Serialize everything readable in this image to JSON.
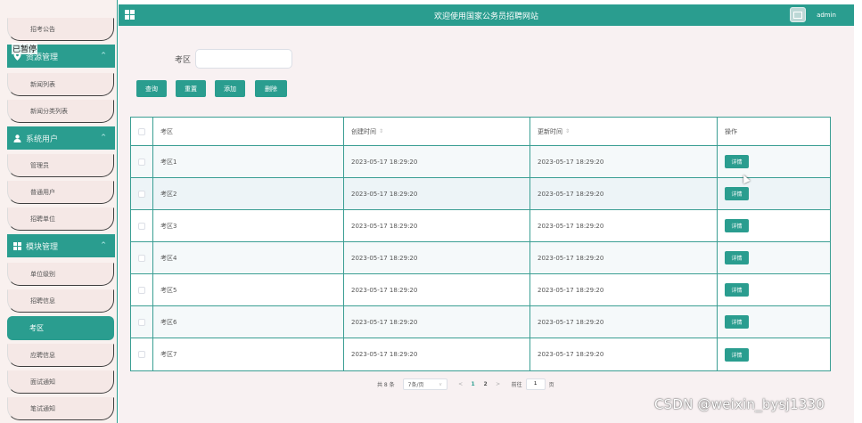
{
  "sidebar": {
    "items": [
      {
        "label": "招考公告",
        "type": "item"
      },
      {
        "label": "资源管理",
        "type": "group",
        "icon": "map-pin-icon"
      },
      {
        "label": "新闻列表",
        "type": "item"
      },
      {
        "label": "新闻分类列表",
        "type": "item"
      },
      {
        "label": "系统用户",
        "type": "group",
        "icon": "user-icon"
      },
      {
        "label": "管理员",
        "type": "item"
      },
      {
        "label": "普通用户",
        "type": "item"
      },
      {
        "label": "招聘单位",
        "type": "item"
      },
      {
        "label": "模块管理",
        "type": "group",
        "icon": "grid-icon"
      },
      {
        "label": "单位级别",
        "type": "item"
      },
      {
        "label": "招聘信息",
        "type": "item"
      },
      {
        "label": "考区",
        "type": "item",
        "active": true
      },
      {
        "label": "应聘信息",
        "type": "item"
      },
      {
        "label": "面试通知",
        "type": "item"
      },
      {
        "label": "笔试通知",
        "type": "item"
      }
    ],
    "paused_label": "已暂停"
  },
  "header": {
    "title": "欢迎使用国家公务员招聘网站",
    "username": "admin"
  },
  "search": {
    "label": "考区",
    "value": "",
    "placeholder": ""
  },
  "toolbar": {
    "query": "查询",
    "reset": "重置",
    "add": "添加",
    "delete": "删除"
  },
  "table": {
    "columns": [
      "考区",
      "创建时间",
      "更新时间",
      "操作"
    ],
    "sort_mark": "⇕",
    "rows": [
      {
        "area": "考区1",
        "created": "2023-05-17 18:29:20",
        "updated": "2023-05-17 18:29:20",
        "action": "详情"
      },
      {
        "area": "考区2",
        "created": "2023-05-17 18:29:20",
        "updated": "2023-05-17 18:29:20",
        "action": "详情"
      },
      {
        "area": "考区3",
        "created": "2023-05-17 18:29:20",
        "updated": "2023-05-17 18:29:20",
        "action": "详情"
      },
      {
        "area": "考区4",
        "created": "2023-05-17 18:29:20",
        "updated": "2023-05-17 18:29:20",
        "action": "详情"
      },
      {
        "area": "考区5",
        "created": "2023-05-17 18:29:20",
        "updated": "2023-05-17 18:29:20",
        "action": "详情"
      },
      {
        "area": "考区6",
        "created": "2023-05-17 18:29:20",
        "updated": "2023-05-17 18:29:20",
        "action": "详情"
      },
      {
        "area": "考区7",
        "created": "2023-05-17 18:29:20",
        "updated": "2023-05-17 18:29:20",
        "action": "详情"
      }
    ]
  },
  "pagination": {
    "total": "共 8 条",
    "page_size": "7条/页",
    "prev": "<",
    "next": ">",
    "pages": [
      "1",
      "2"
    ],
    "current_page": "1",
    "goto_label": "前往",
    "goto_value": "1",
    "page_unit": "页"
  },
  "watermark": "CSDN @weixin_bysj1330",
  "colors": {
    "accent": "#2a9d8f",
    "sidebar_bg": "#f9f1ef",
    "content_bg": "#f8f1f2"
  }
}
